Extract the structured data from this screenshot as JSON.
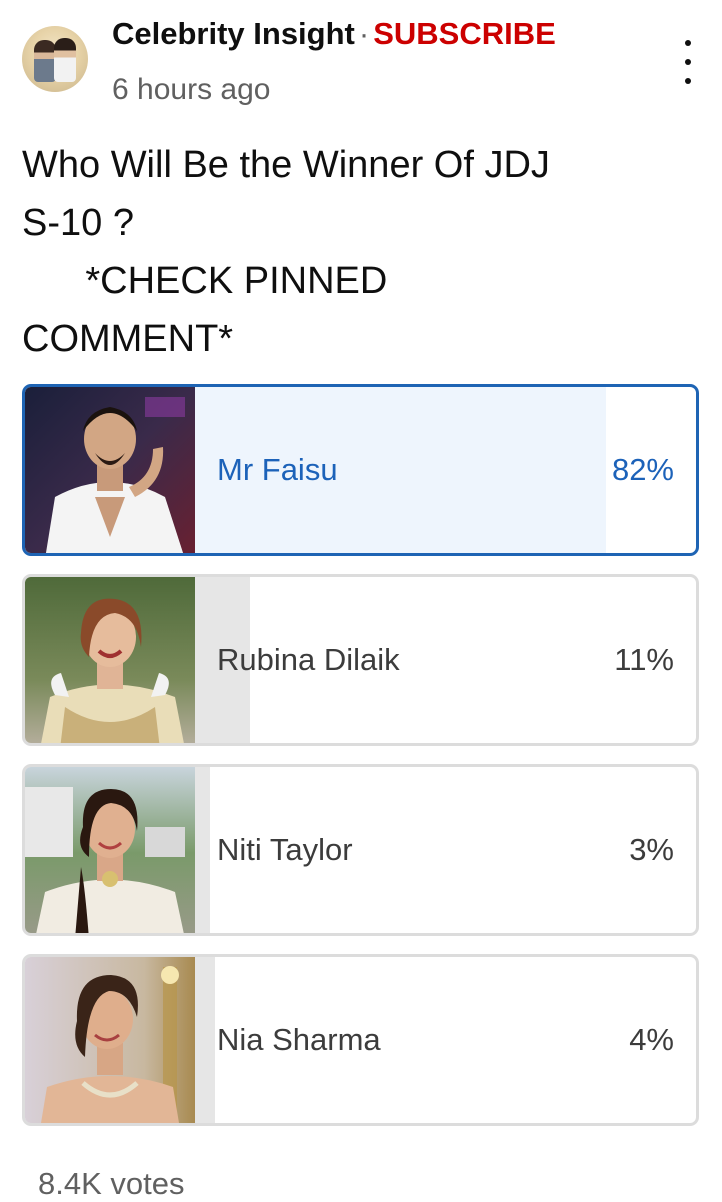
{
  "post": {
    "channel": "Celebrity Insight",
    "separator": "·",
    "subscribe": "SUBSCRIBE",
    "time": "6 hours ago",
    "menu_icon": "more-vertical-icon",
    "question": "Who Will Be the Winner Of JDJ\nS-10 ?\n      *CHECK PINNED\nCOMMENT*"
  },
  "poll": {
    "options": [
      {
        "name": "Mr Faisu",
        "percent": "82%",
        "fraction": 0.82,
        "selected": true
      },
      {
        "name": "Rubina Dilaik",
        "percent": "11%",
        "fraction": 0.11,
        "selected": false
      },
      {
        "name": "Niti Taylor",
        "percent": "3%",
        "fraction": 0.03,
        "selected": false
      },
      {
        "name": "Nia Sharma",
        "percent": "4%",
        "fraction": 0.04,
        "selected": false
      }
    ],
    "votes": "8.4K votes"
  },
  "colors": {
    "selected_border": "#1e64b4",
    "selected_text": "#1c62b9",
    "subscribe": "#cc0000"
  }
}
